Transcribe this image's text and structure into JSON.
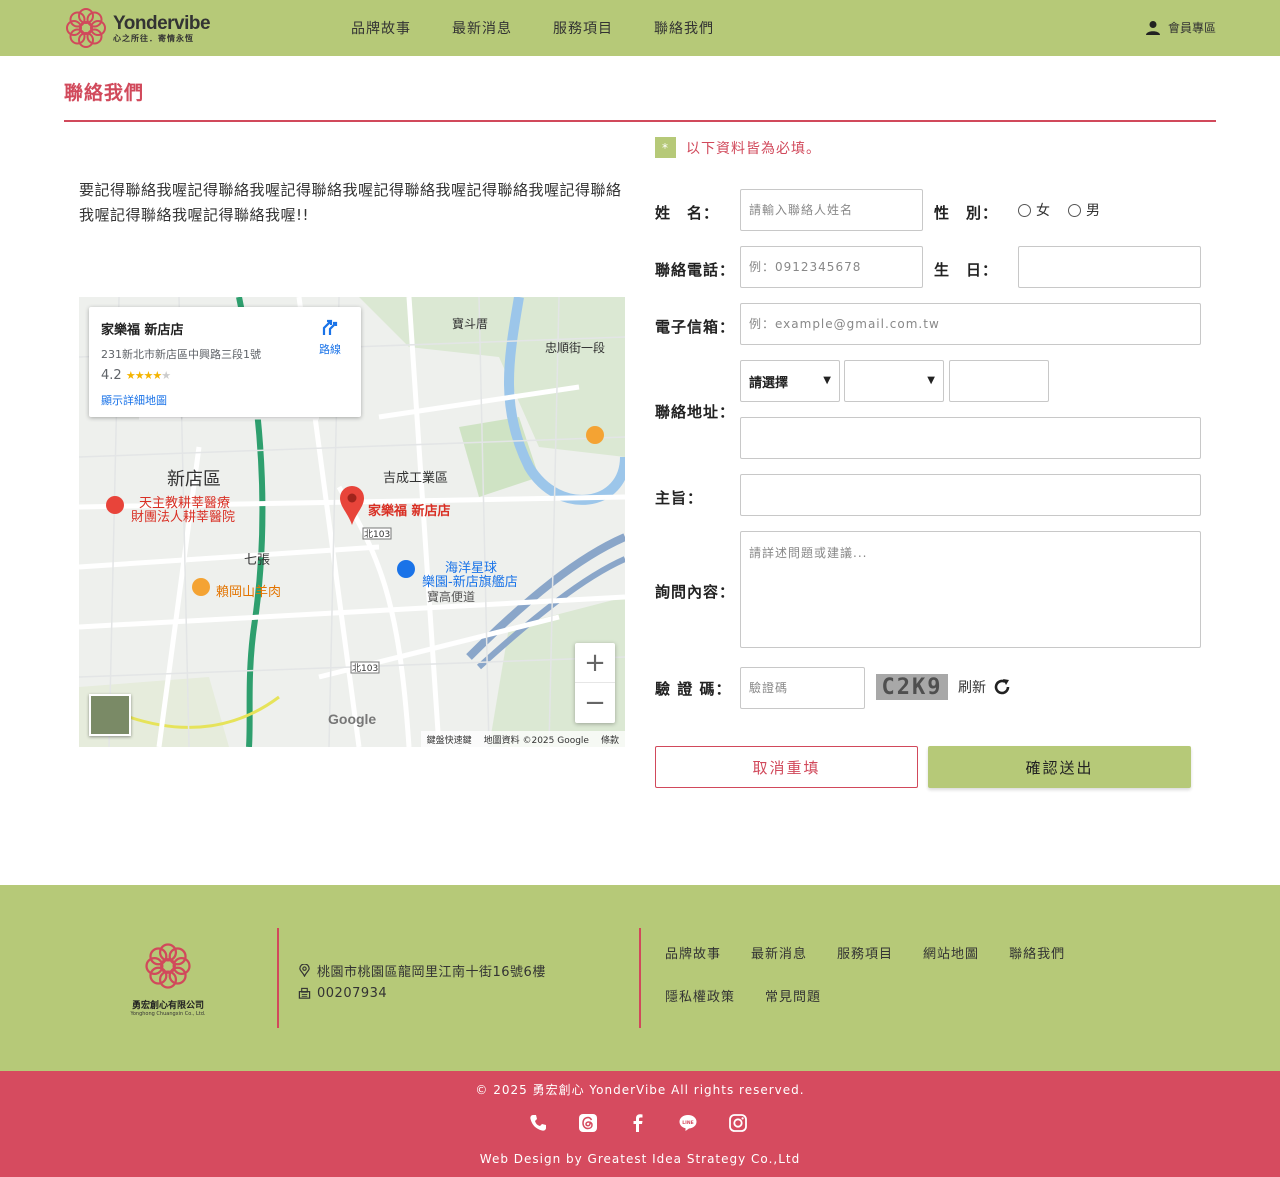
{
  "header": {
    "logo_name": "Yondervibe",
    "logo_tagline": "心之所往．寄情永恆",
    "nav": [
      "品牌故事",
      "最新消息",
      "服務項目",
      "聯絡我們"
    ],
    "member_label": "會員專區"
  },
  "page": {
    "title": "聯絡我們",
    "intro": "要記得聯絡我喔記得聯絡我喔記得聯絡我喔記得聯絡我喔記得聯絡我喔記得聯絡我喔記得聯絡我喔記得聯絡我喔!!"
  },
  "map": {
    "place_name": "家樂福 新店店",
    "address": "231新北市新店區中興路三段1號",
    "rating": "4.2",
    "directions_label": "路線",
    "larger_map_label": "顯示詳細地圖",
    "pin_label": "家樂福 新店店",
    "labels": [
      "新店區",
      "吉成工業區",
      "天主教耕莘醫療",
      "財團法人耕莘醫院",
      "七張",
      "賴岡山羊肉",
      "海洋星球",
      "樂園-新店旗艦店",
      "寶高便道",
      "寶斗厝",
      "忠順街一段",
      "北103",
      "北103"
    ],
    "google_label": "Google",
    "footer_items": [
      "鍵盤快速鍵",
      "地圖資料 ©2025 Google",
      "條款"
    ]
  },
  "form": {
    "required_note": "以下資料皆為必填。",
    "required_mark": "*",
    "name_label": "姓　名：",
    "name_placeholder": "請輸入聯絡人姓名",
    "gender_label": "性　別：",
    "gender_options": [
      "女",
      "男"
    ],
    "phone_label": "聯絡電話：",
    "phone_placeholder": "例：0912345678",
    "birthday_label": "生　日：",
    "email_label": "電子信箱：",
    "email_placeholder": "例：example@gmail.com.tw",
    "address_label": "聯絡地址：",
    "city_select": "請選擇",
    "subject_label": "主旨：",
    "message_label": "詢問內容：",
    "message_placeholder": "請詳述問題或建議...",
    "captcha_label": "驗 證 碼：",
    "captcha_placeholder": "驗證碼",
    "captcha_code": "C2K9",
    "refresh_label": "刷新",
    "cancel_button": "取消重填",
    "submit_button": "確認送出"
  },
  "footer": {
    "company_name": "勇宏創心有限公司",
    "company_name_en": "Yonghong Chuangxin Co., Ltd.",
    "address": "桃園市桃園區龍岡里江南十街16號6樓",
    "tax_id": "00207934",
    "links_row1": [
      "品牌故事",
      "最新消息",
      "服務項目",
      "網站地圖",
      "聯絡我們"
    ],
    "links_row2": [
      "隱私權政策",
      "常見問題"
    ],
    "copyright": "© 2025 勇宏創心 YonderVibe All rights reserved.",
    "credit": "Web Design by Greatest Idea Strategy Co.,Ltd"
  },
  "colors": {
    "brand_green": "#b6c978",
    "brand_red": "#d1495b",
    "bottom_bar": "#d64b5f"
  },
  "icons": [
    "user-icon",
    "directions-icon",
    "location-pin-icon",
    "fax-icon",
    "refresh-icon",
    "phone-icon",
    "threads-icon",
    "facebook-icon",
    "line-icon",
    "instagram-icon"
  ]
}
